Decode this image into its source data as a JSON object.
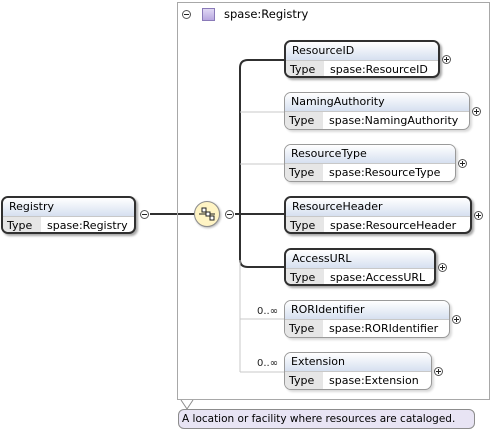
{
  "root": {
    "name": "Registry",
    "type_key": "Type",
    "type_value": "spase:Registry"
  },
  "complex_type": {
    "title": "spase:Registry"
  },
  "children": [
    {
      "name": "ResourceID",
      "type_key": "Type",
      "type_value": "spase:ResourceID",
      "required": true,
      "occurrence": ""
    },
    {
      "name": "NamingAuthority",
      "type_key": "Type",
      "type_value": "spase:NamingAuthority",
      "required": false,
      "occurrence": ""
    },
    {
      "name": "ResourceType",
      "type_key": "Type",
      "type_value": "spase:ResourceType",
      "required": false,
      "occurrence": ""
    },
    {
      "name": "ResourceHeader",
      "type_key": "Type",
      "type_value": "spase:ResourceHeader",
      "required": true,
      "occurrence": ""
    },
    {
      "name": "AccessURL",
      "type_key": "Type",
      "type_value": "spase:AccessURL",
      "required": true,
      "occurrence": ""
    },
    {
      "name": "RORIdentifier",
      "type_key": "Type",
      "type_value": "spase:RORIdentifier",
      "required": false,
      "occurrence": "0..∞"
    },
    {
      "name": "Extension",
      "type_key": "Type",
      "type_value": "spase:Extension",
      "required": false,
      "occurrence": "0..∞"
    }
  ],
  "documentation": "A location or facility where resources are cataloged.",
  "icons": {
    "collapse": "minus-circle-icon",
    "expand": "plus-circle-icon",
    "complex_type": "complex-type-icon",
    "sequence": "sequence-compositor-icon"
  },
  "colors": {
    "header_gradient_top": "#ffffff",
    "header_gradient_bottom": "#d6e0f0",
    "type_key_bg": "#e6e6e6",
    "doc_bg": "#e8e4f4",
    "compositor_bg": "#fff4c4"
  }
}
